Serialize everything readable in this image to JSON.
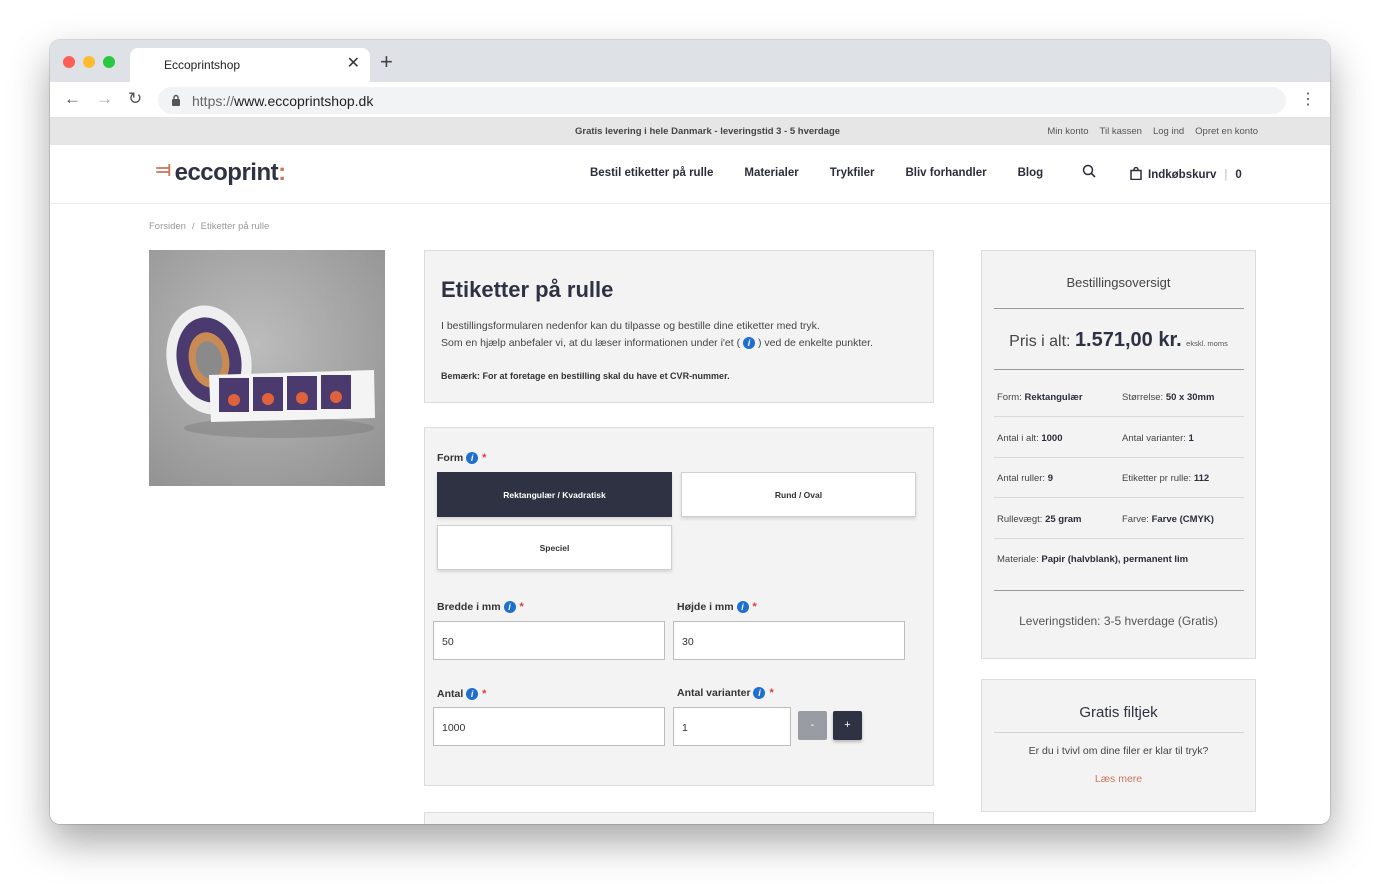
{
  "browser": {
    "tab_title": "Eccoprintshop",
    "tab_close": "✕",
    "new_tab": "+",
    "back": "←",
    "forward": "→",
    "reload": "↻",
    "url_scheme": "https://",
    "url_host": "www.eccoprintshop.dk",
    "menu": "⋮"
  },
  "topbar": {
    "promo": "Gratis levering i hele Danmark - leveringstid 3 - 5 hverdage",
    "links": [
      "Min konto",
      "Til kassen",
      "Log ind",
      "Opret en konto"
    ]
  },
  "header": {
    "logo_text": "eccoprint",
    "nav": [
      "Bestil etiketter på rulle",
      "Materialer",
      "Trykfiler",
      "Bliv forhandler",
      "Blog"
    ],
    "cart_label": "Indkøbskurv",
    "cart_count": "0"
  },
  "breadcrumb": [
    "Forsiden",
    "Etiketter på rulle"
  ],
  "intro": {
    "title": "Etiketter på rulle",
    "line1": "I bestillingsformularen nedenfor kan du tilpasse og bestille dine etiketter med tryk.",
    "line2_before": "Som en hjælp anbefaler vi, at du læser informationen under i'et (",
    "line2_after": ") ved de enkelte punkter.",
    "note": "Bemærk: For at foretage en bestilling skal du have et CVR-nummer."
  },
  "form": {
    "shape_label": "Form",
    "shape_options": [
      "Rektangulær / Kvadratisk",
      "Rund / Oval",
      "Speciel"
    ],
    "selected_shape": 0,
    "width_label": "Bredde i mm",
    "width_value": "50",
    "height_label": "Højde i mm",
    "height_value": "30",
    "qty_label": "Antal",
    "qty_value": "1000",
    "variants_label": "Antal varianter",
    "variants_value": "1",
    "minus": "-",
    "plus": "+",
    "info_glyph": "i",
    "required_mark": "*"
  },
  "summary": {
    "title": "Bestillingsoversigt",
    "price_label": "Pris i alt:",
    "price_value": "1.571,00 kr.",
    "price_vat": "ekskl. moms",
    "rows": [
      {
        "l1": "Form:",
        "v1": "Rektangulær",
        "l2": "Størrelse:",
        "v2": "50 x 30mm"
      },
      {
        "l1": "Antal i alt:",
        "v1": "1000",
        "l2": "Antal varianter:",
        "v2": "1"
      },
      {
        "l1": "Antal ruller:",
        "v1": "9",
        "l2": "Etiketter pr rulle:",
        "v2": "112"
      },
      {
        "l1": "Rullevægt:",
        "v1": "25 gram",
        "l2": "Farve:",
        "v2": "Farve (CMYK)"
      },
      {
        "l1": "Materiale:",
        "v1": "Papir (halvblank), permanent lim"
      }
    ],
    "delivery": "Leveringstiden: 3-5 hverdage (Gratis)"
  },
  "filecheck": {
    "title": "Gratis filtjek",
    "question": "Er du i tvivl om dine filer er klar til tryk?",
    "link": "Læs mere"
  },
  "colors": {
    "brand_dark": "#2f3243",
    "brand_accent": "#c9775a",
    "info_blue": "#1e6fd0",
    "required_red": "#e53935"
  }
}
